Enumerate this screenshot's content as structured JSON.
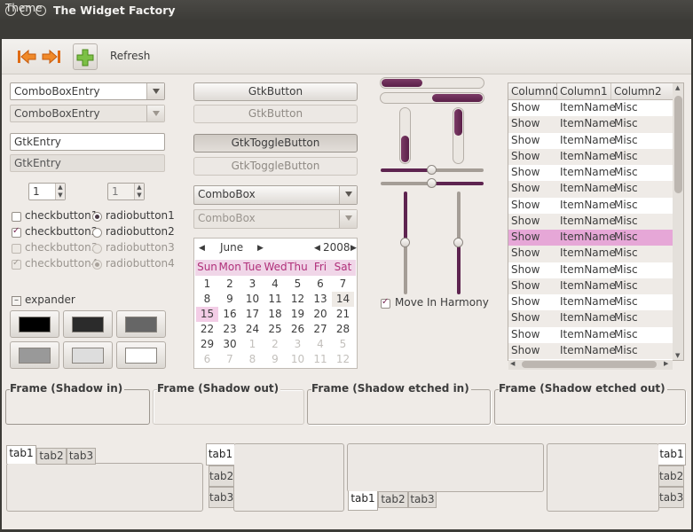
{
  "window": {
    "title": "The Widget Factory"
  },
  "menubar": {
    "theme": "Theme"
  },
  "toolbar": {
    "refresh": "Refresh"
  },
  "colors": {
    "accent": "#5e2450",
    "selection": "#e6a7d7",
    "calendar_header": "#f0d6e8"
  },
  "left": {
    "combo_entry": "ComboBoxEntry",
    "combo_entry_disabled": "ComboBoxEntry",
    "entry": "GtkEntry",
    "entry_disabled": "GtkEntry",
    "spin": "1",
    "spin_disabled": "1",
    "check1": "checkbutton1",
    "check2": "checkbutton2",
    "check3": "checkbutton3",
    "check4": "checkbutton4",
    "radio1": "radiobutton1",
    "radio2": "radiobutton2",
    "radio3": "radiobutton3",
    "radio4": "radiobutton4",
    "expander": "expander",
    "swatches": [
      "#000000",
      "#2b2b2b",
      "#666666",
      "#999999",
      "#dddddd",
      "#ffffff"
    ]
  },
  "middle": {
    "button": "GtkButton",
    "button_disabled": "GtkButton",
    "toggle": "GtkToggleButton",
    "toggle_disabled": "GtkToggleButton",
    "combo": "ComboBox",
    "combo_disabled": "ComboBox"
  },
  "calendar": {
    "month": "June",
    "year": "2008",
    "days_of_week": [
      "Sun",
      "Mon",
      "Tue",
      "Wed",
      "Thu",
      "Fri",
      "Sat"
    ],
    "weeks": [
      [
        "1",
        "2",
        "3",
        "4",
        "5",
        "6",
        "7"
      ],
      [
        "8",
        "9",
        "10",
        "11",
        "12",
        "13",
        "14"
      ],
      [
        "15",
        "16",
        "17",
        "18",
        "19",
        "20",
        "21"
      ],
      [
        "22",
        "23",
        "24",
        "25",
        "26",
        "27",
        "28"
      ],
      [
        "29",
        "30",
        "1",
        "2",
        "3",
        "4",
        "5"
      ],
      [
        "6",
        "7",
        "8",
        "9",
        "10",
        "11",
        "12"
      ]
    ],
    "selected_day": "15",
    "today": "14"
  },
  "scales": {
    "move_in_harmony": "Move In Harmony",
    "progress_h1": 0.4,
    "progress_h2": 0.5,
    "progress_v1": 0.5,
    "progress_v2": 0.5,
    "scale_value": 0.5
  },
  "tree": {
    "columns": [
      "Column0",
      "Column1",
      "Column2"
    ],
    "rows": [
      [
        "Show",
        "ItemName",
        "Misc"
      ],
      [
        "Show",
        "ItemName",
        "Misc"
      ],
      [
        "Show",
        "ItemName",
        "Misc"
      ],
      [
        "Show",
        "ItemName",
        "Misc"
      ],
      [
        "Show",
        "ItemName",
        "Misc"
      ],
      [
        "Show",
        "ItemName",
        "Misc"
      ],
      [
        "Show",
        "ItemName",
        "Misc"
      ],
      [
        "Show",
        "ItemName",
        "Misc"
      ],
      [
        "Show",
        "ItemName",
        "Misc"
      ],
      [
        "Show",
        "ItemName",
        "Misc"
      ],
      [
        "Show",
        "ItemName",
        "Misc"
      ],
      [
        "Show",
        "ItemName",
        "Misc"
      ],
      [
        "Show",
        "ItemName",
        "Misc"
      ],
      [
        "Show",
        "ItemName",
        "Misc"
      ],
      [
        "Show",
        "ItemName",
        "Misc"
      ],
      [
        "Show",
        "ItemName",
        "Misc"
      ]
    ],
    "selected_row": 8
  },
  "frames": [
    "Frame (Shadow in)",
    "Frame (Shadow out)",
    "Frame (Shadow etched in)",
    "Frame (Shadow etched out)"
  ],
  "notebooks": {
    "tabs": [
      "tab1",
      "tab2",
      "tab3"
    ]
  }
}
